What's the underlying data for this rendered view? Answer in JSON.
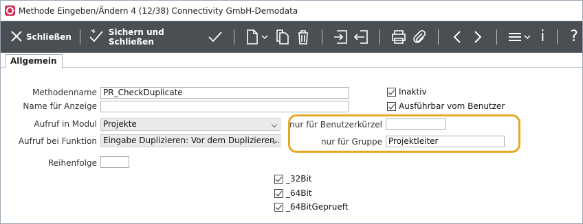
{
  "window": {
    "title": "Methode Eingeben/Ändern 4 (12/38) Connectivity GmbH-Demodata",
    "accent": "#d3315b"
  },
  "toolbar": {
    "close_label": "Schließen",
    "save_close_label": "Sichern und Schließen",
    "info_label": "i",
    "help_label": "?",
    "bg": "#4a4f54"
  },
  "tabs": [
    {
      "label": "Allgemein",
      "active": true
    }
  ],
  "form": {
    "methodenname": {
      "label": "Methodenname",
      "value": "PR_CheckDuplicate"
    },
    "name_anzeige": {
      "label": "Name für Anzeige",
      "value": ""
    },
    "aufruf_modul": {
      "label": "Aufruf in Modul",
      "value": "Projekte"
    },
    "aufruf_funktion": {
      "label": "Aufruf bei Funktion",
      "value": "Eingabe Duplizieren: Vor dem Duplizieren..."
    },
    "reihenfolge": {
      "label": "Reihenfolge",
      "value": ""
    },
    "benutzerkuerzel": {
      "label": "nur für Benutzerkürzel",
      "value": ""
    },
    "gruppe": {
      "label": "nur für Gruppe",
      "value": "Projektleiter"
    },
    "inaktiv": {
      "label": "Inaktiv",
      "checked": true
    },
    "ausfuehrbar": {
      "label": "Ausführbar vom Benutzer",
      "checked": true
    },
    "bit32": {
      "label": "_32Bit",
      "checked": true
    },
    "bit64": {
      "label": "_64Bit",
      "checked": true
    },
    "bit64geprueft": {
      "label": "_64BitGeprueft",
      "checked": true
    },
    "highlight_color": "#e8a623"
  }
}
